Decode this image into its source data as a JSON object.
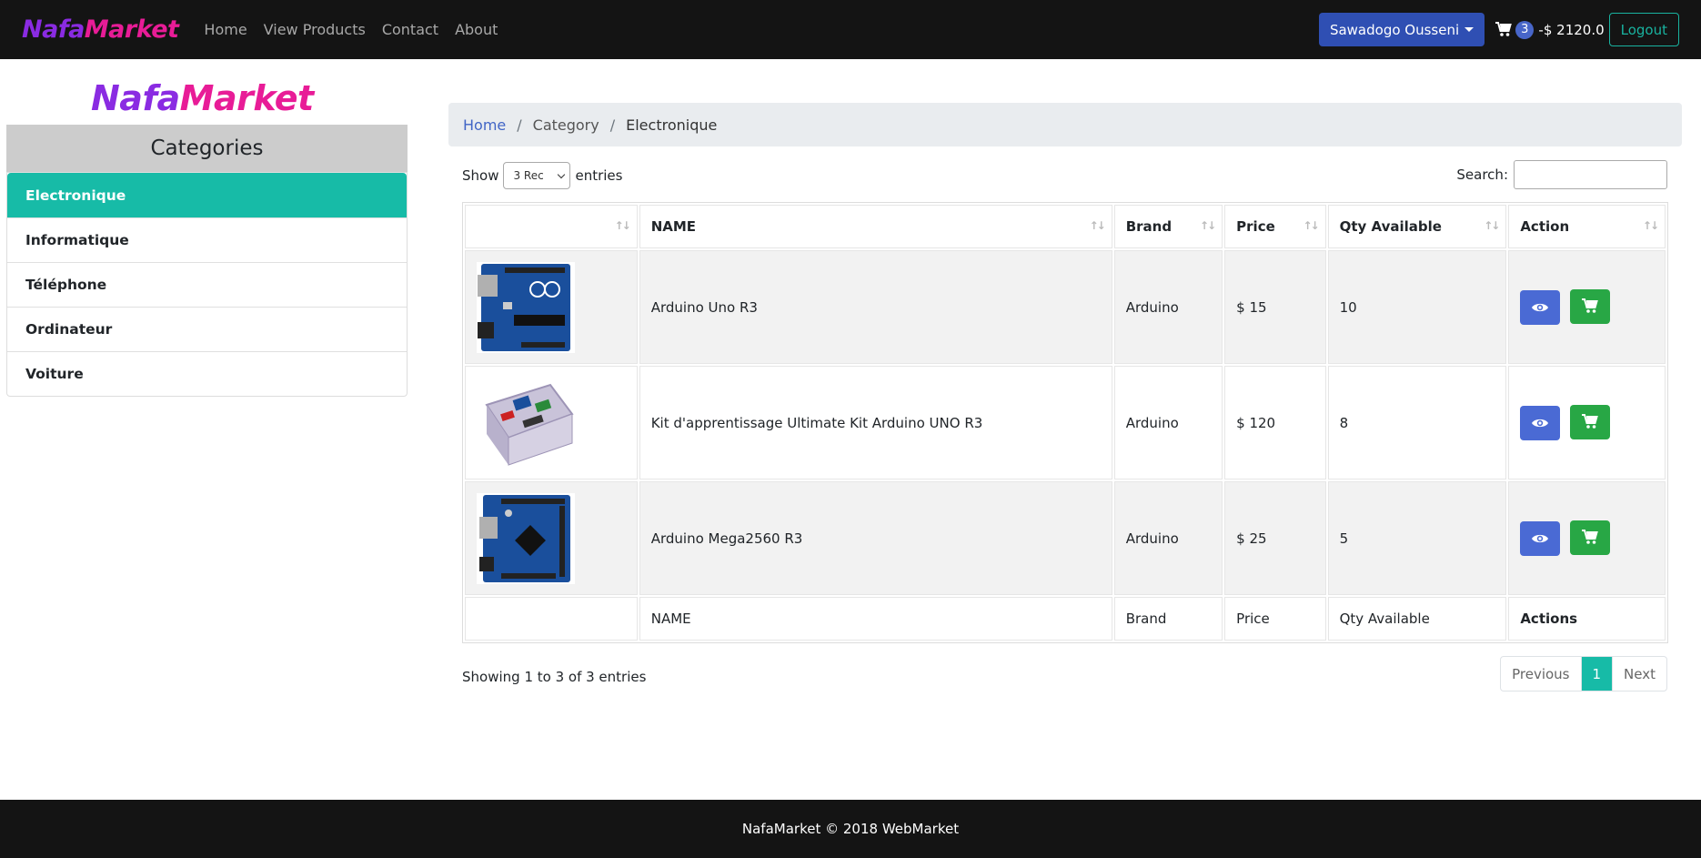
{
  "navbar": {
    "brand_part1": "Nafa",
    "brand_part2": "Market",
    "links": [
      "Home",
      "View Products",
      "Contact",
      "About"
    ],
    "user_name": "Sawadogo Ousseni",
    "cart_count": "3",
    "cart_total": "-$ 2120.0",
    "logout_label": "Logout"
  },
  "sidebar": {
    "logo_part1": "Nafa",
    "logo_part2": "Market",
    "header": "Categories",
    "items": [
      {
        "label": "Electronique",
        "active": true
      },
      {
        "label": "Informatique",
        "active": false
      },
      {
        "label": "Téléphone",
        "active": false
      },
      {
        "label": "Ordinateur",
        "active": false
      },
      {
        "label": "Voiture",
        "active": false
      }
    ]
  },
  "breadcrumb": {
    "home": "Home",
    "category": "Category",
    "current": "Electronique"
  },
  "table_controls": {
    "show_label": "Show",
    "entries_value": "3 Rec",
    "entries_label": "entries",
    "search_label": "Search:",
    "search_value": ""
  },
  "table": {
    "headers": [
      "",
      "NAME",
      "Brand",
      "Price",
      "Qty Available",
      "Action"
    ],
    "footers": [
      "",
      "NAME",
      "Brand",
      "Price",
      "Qty Available",
      "Actions"
    ],
    "rows": [
      {
        "image": "arduino-uno-board",
        "name": "Arduino Uno R3",
        "brand": "Arduino",
        "price": "$ 15",
        "qty": "10"
      },
      {
        "image": "arduino-kit-box",
        "name": "Kit d'apprentissage Ultimate Kit Arduino UNO R3",
        "brand": "Arduino",
        "price": "$ 120",
        "qty": "8"
      },
      {
        "image": "arduino-mega-board",
        "name": "Arduino Mega2560 R3",
        "brand": "Arduino",
        "price": "$ 25",
        "qty": "5"
      }
    ]
  },
  "pagination": {
    "info": "Showing 1 to 3 of 3 entries",
    "previous": "Previous",
    "current": "1",
    "next": "Next"
  },
  "footer": {
    "text": "NafaMarket © 2018 WebMarket"
  },
  "colors": {
    "navbar_bg": "#141414",
    "accent_teal": "#17bba7",
    "primary_blue": "#2f4fb3",
    "success_green": "#28a745",
    "brand_purple": "#8a2be2",
    "brand_pink": "#e81c97"
  },
  "icons": [
    "cart-icon",
    "eye-icon",
    "sort-icon",
    "chevron-down-icon"
  ]
}
